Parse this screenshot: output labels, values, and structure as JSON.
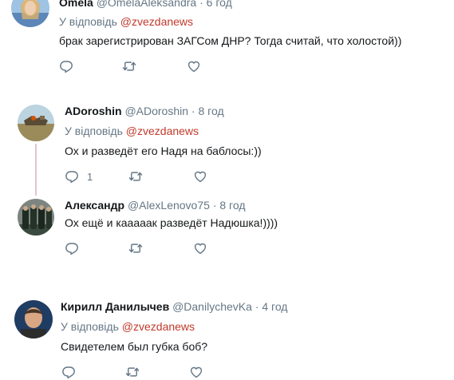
{
  "tweets": [
    {
      "name": "Omela",
      "handle": "@OmelaAleksandra",
      "time": "6 год",
      "reply_prefix": "У відповідь",
      "reply_to": "@zvezdanews",
      "text": "брак зарегистрирован ЗАГСом ДНР? Тогда считай, что холостой))"
    },
    {
      "name": "ADoroshin",
      "handle": "@ADoroshin",
      "time": "8 год",
      "reply_prefix": "У відповідь",
      "reply_to": "@zvezdanews",
      "text": "Ох и разведёт его Надя на баблосы:))",
      "reply_count": "1"
    },
    {
      "name": "Александр",
      "handle": "@AlexLenovo75",
      "time": "8 год",
      "text": "Ох ещё и кааааак разведёт Надюшка!))))"
    },
    {
      "name": "Кирилл Данилычев",
      "handle": "@DanilychevKa",
      "time": "4 год",
      "reply_prefix": "У відповідь",
      "reply_to": "@zvezdanews",
      "text": "Свидетелем был губка боб?"
    }
  ],
  "separator": "·",
  "colors": {
    "mention": "#c0392b",
    "muted": "#657786",
    "thread_line": "#e6c3cf"
  },
  "icons": [
    "reply-icon",
    "retweet-icon",
    "like-icon"
  ]
}
